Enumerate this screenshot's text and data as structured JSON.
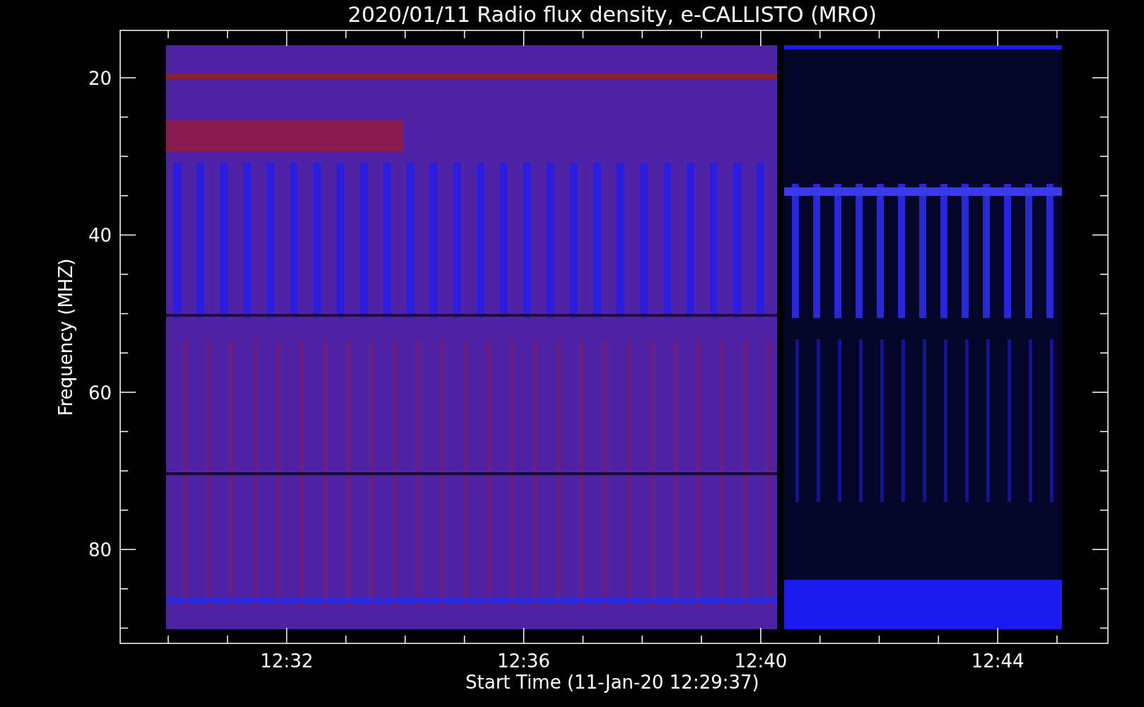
{
  "title": "2020/01/11  Radio flux density, e-CALLISTO (MRO)",
  "y_axis": {
    "label": "Frequency (MHZ)",
    "tick_labels": [
      "20",
      "40",
      "60",
      "80"
    ]
  },
  "x_axis": {
    "label": "Start Time (11-Jan-20 12:29:37)",
    "tick_labels": [
      "12:32",
      "12:36",
      "12:40",
      "12:44"
    ]
  }
}
